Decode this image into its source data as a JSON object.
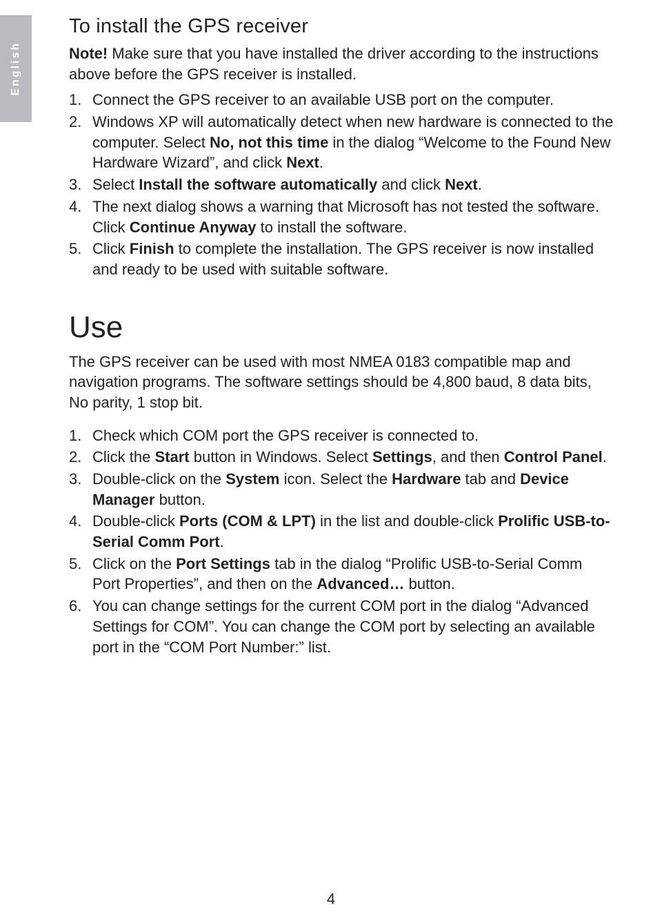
{
  "side_tab": "English",
  "section1": {
    "title": "To install the GPS receiver",
    "note_prefix": "Note! ",
    "note_text": "Make sure that you have installed the driver according to the instructions above before the GPS receiver is installed.",
    "items": {
      "i1": "Connect the GPS receiver to an available USB port on the computer.",
      "i2a": "Windows XP will automatically detect when new hardware is connected to the computer. Select ",
      "i2b": "No, not this time",
      "i2c": " in the dialog “Welcome to the Found New Hardware Wizard”, and click ",
      "i2d": "Next",
      "i2e": ".",
      "i3a": "Select ",
      "i3b": "Install the software automatically",
      "i3c": " and click ",
      "i3d": "Next",
      "i3e": ".",
      "i4a": "The next dialog shows a warning that Microsoft has not tested the software. Click ",
      "i4b": "Continue Anyway",
      "i4c": " to install the software.",
      "i5a": "Click ",
      "i5b": "Finish",
      "i5c": " to complete the installation. The GPS receiver is now installed and ready to be used with suitable software."
    }
  },
  "section2": {
    "title": "Use",
    "intro": "The GPS receiver can be used with most NMEA 0183 compatible map and navigation programs. The software settings should be 4,800 baud, 8 data bits, No parity, 1 stop bit.",
    "items": {
      "i1": "Check which COM port the GPS receiver is connected to.",
      "i2a": "Click the ",
      "i2b": "Start",
      "i2c": " button in Windows. Select ",
      "i2d": "Settings",
      "i2e": ", and then ",
      "i2f": "Control Panel",
      "i2g": ".",
      "i3a": "Double-click on the ",
      "i3b": "System",
      "i3c": " icon. Select the ",
      "i3d": "Hardware",
      "i3e": " tab and ",
      "i3f": "Device Manager",
      "i3g": " button.",
      "i4a": "Double-click ",
      "i4b": "Ports (COM & LPT)",
      "i4c": " in the list and double-click ",
      "i4d": "Prolific USB-to-Serial Comm Port",
      "i4e": ".",
      "i5a": "Click on the ",
      "i5b": "Port Settings",
      "i5c": " tab in the dialog “Prolific USB-to-Serial Comm Port Properties”, and then on the ",
      "i5d": "Advanced…",
      "i5e": " button.",
      "i6": "You can change settings for the current COM port in the dialog “Advanced Settings for COM”. You can change the COM port by selecting an available port in the “COM Port Number:” list."
    }
  },
  "page_number": "4"
}
